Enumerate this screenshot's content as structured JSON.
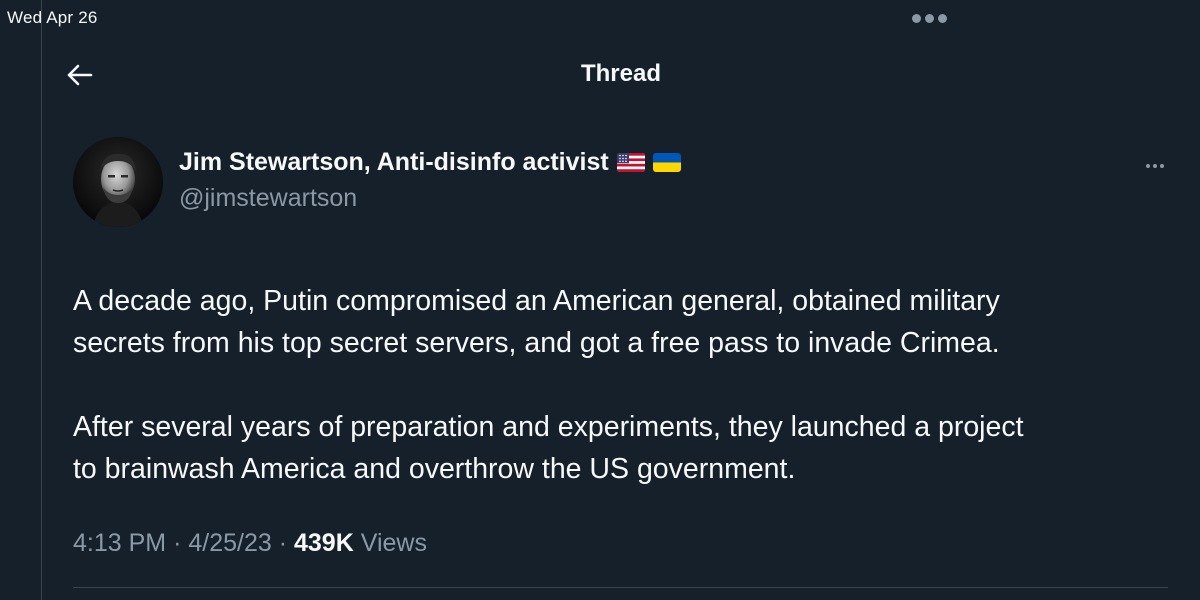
{
  "status_bar": {
    "date": "Wed Apr 26"
  },
  "header": {
    "title": "Thread",
    "back_icon": "arrow-left-icon"
  },
  "tweet": {
    "author": {
      "name": "Jim Stewartson, Anti-disinfo activist",
      "handle": "@jimstewartson",
      "flags": [
        "us-flag-icon",
        "ukraine-flag-icon"
      ]
    },
    "text": [
      "A decade ago, Putin compromised an American general, obtained military\nsecrets from his top secret servers, and got a free pass to invade Crimea.",
      "After several years of preparation and experiments, they launched a project\nto brainwash America and overthrow the US government."
    ],
    "time": "4:13 PM",
    "separator": "·",
    "date": "4/25/23",
    "views_count": "439K",
    "views_label": "Views"
  },
  "colors": {
    "background": "#15202b",
    "text_primary": "#f7f9f9",
    "text_secondary": "#8b98a5",
    "divider": "#38444d"
  }
}
